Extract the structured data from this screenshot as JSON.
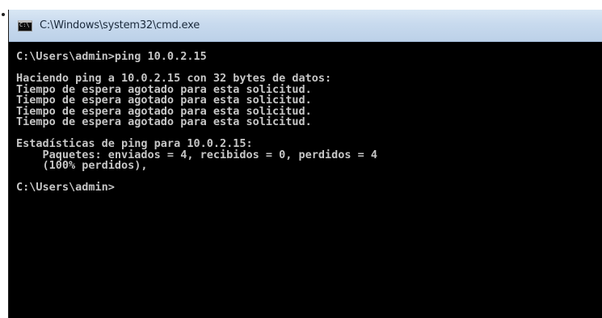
{
  "window": {
    "title": "C:\\Windows\\system32\\cmd.exe",
    "icon": "cmd-icon",
    "icon_glyph": "C:\\"
  },
  "console": {
    "lines": [
      "C:\\Users\\admin>ping 10.0.2.15",
      "",
      "Haciendo ping a 10.0.2.15 con 32 bytes de datos:",
      "Tiempo de espera agotado para esta solicitud.",
      "Tiempo de espera agotado para esta solicitud.",
      "Tiempo de espera agotado para esta solicitud.",
      "Tiempo de espera agotado para esta solicitud.",
      "",
      "Estadísticas de ping para 10.0.2.15:",
      "    Paquetes: enviados = 4, recibidos = 0, perdidos = 4",
      "    (100% perdidos),",
      "",
      "C:\\Users\\admin>"
    ]
  },
  "colors": {
    "console_background": "#000000",
    "console_text": "#c6c6c6",
    "titlebar": "#c8daee"
  }
}
